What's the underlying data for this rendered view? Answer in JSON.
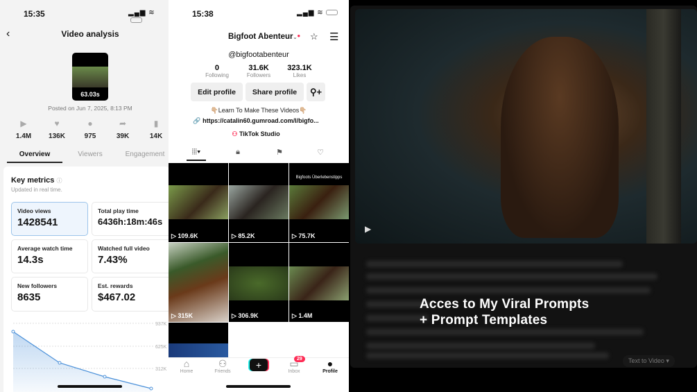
{
  "left": {
    "time": "15:35",
    "title": "Video analysis",
    "duration": "63.03s",
    "posted": "Posted on Jun 7, 2025, 8:13 PM",
    "stats": [
      {
        "icon": "play-icon",
        "value": "1.4M"
      },
      {
        "icon": "heart-icon",
        "value": "136K"
      },
      {
        "icon": "comment-icon",
        "value": "975"
      },
      {
        "icon": "share-icon",
        "value": "39K"
      },
      {
        "icon": "bookmark-icon",
        "value": "14K"
      }
    ],
    "tabs": [
      "Overview",
      "Viewers",
      "Engagement"
    ],
    "key_metrics": {
      "title": "Key metrics",
      "subtitle": "Updated in real time.",
      "items": [
        {
          "label": "Video views",
          "value": "1428541"
        },
        {
          "label": "Total play time",
          "value": "6436h:18m:46s"
        },
        {
          "label": "Average watch time",
          "value": "14.3s"
        },
        {
          "label": "Watched full video",
          "value": "7.43%"
        },
        {
          "label": "New followers",
          "value": "8635"
        },
        {
          "label": "Est. rewards",
          "value": "$467.02"
        }
      ]
    },
    "chart_data": {
      "type": "area",
      "y_ticks": [
        "937K",
        "625K",
        "312K"
      ],
      "ylim": [
        0,
        1250000
      ],
      "values": [
        1000000,
        550000,
        350000,
        170000
      ],
      "color": "#4a90d9"
    }
  },
  "mid": {
    "time": "15:38",
    "name": "Bigfoot Abenteur",
    "handle": "@bigfootabenteur",
    "counts": [
      {
        "value": "0",
        "label": "Following"
      },
      {
        "value": "31.6K",
        "label": "Followers"
      },
      {
        "value": "323.1K",
        "label": "Likes"
      }
    ],
    "edit_label": "Edit profile",
    "share_label": "Share profile",
    "bio": "👇🏼Learn To Make These Videos👇🏼",
    "link": "https://catalin60.gumroad.com/l/bigfo...",
    "studio": "TikTok Studio",
    "videos": [
      {
        "views": "109.6K",
        "caption": ""
      },
      {
        "views": "85.2K",
        "caption": ""
      },
      {
        "views": "75.7K",
        "caption": "Bigfoots Überlebenstipps"
      },
      {
        "views": "315K",
        "caption": ""
      },
      {
        "views": "306.9K",
        "caption": ""
      },
      {
        "views": "1.4M",
        "caption": ""
      }
    ],
    "nav": [
      "Home",
      "Friends",
      "",
      "Inbox",
      "Profile"
    ],
    "inbox_badge": "29"
  },
  "right": {
    "headline1": "Acces to My Viral Prompts",
    "headline2": "+ Prompt Templates",
    "mode": "Text to Video"
  }
}
